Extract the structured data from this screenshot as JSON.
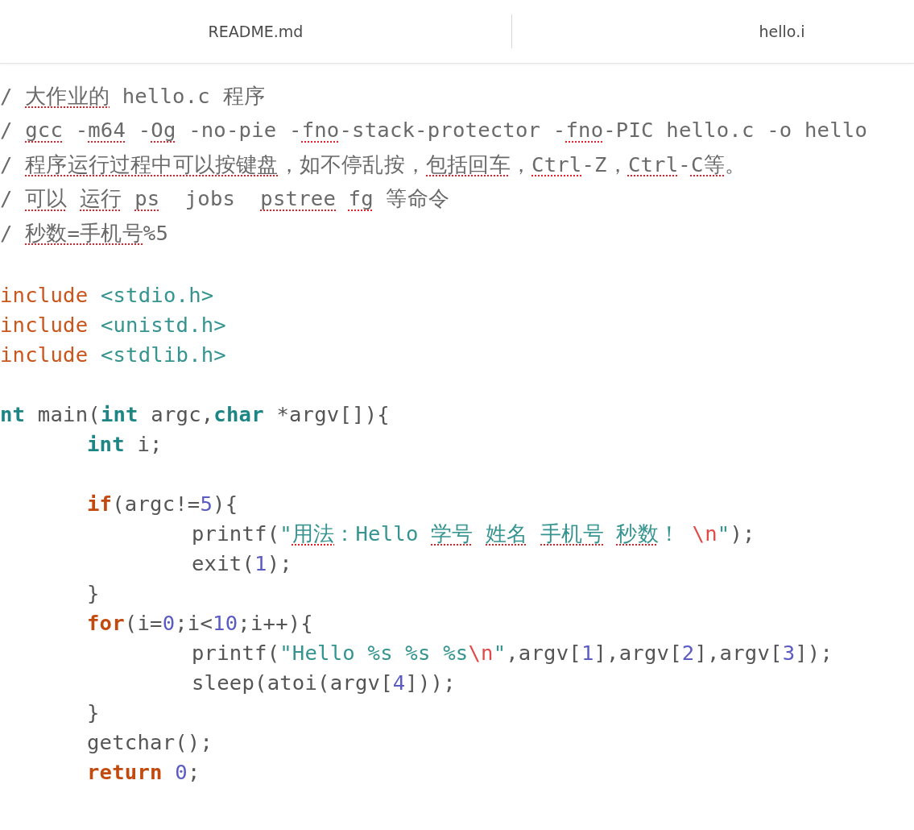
{
  "tabs": [
    {
      "label": "README.md",
      "selected": false
    },
    {
      "label": "hello.i",
      "selected": false
    }
  ],
  "code_lines": [
    {
      "kind": "comment",
      "tokens": [
        {
          "text": "/ ",
          "kind": "comment",
          "misspelled": false
        },
        {
          "text": "大作业的",
          "kind": "comment",
          "misspelled": true
        },
        {
          "text": " hello.c 程序",
          "kind": "comment",
          "misspelled": false
        }
      ]
    },
    {
      "kind": "comment",
      "tokens": [
        {
          "text": "/ ",
          "kind": "comment",
          "misspelled": false
        },
        {
          "text": "gcc",
          "kind": "comment",
          "misspelled": true
        },
        {
          "text": " -",
          "kind": "comment",
          "misspelled": false
        },
        {
          "text": "m64",
          "kind": "comment",
          "misspelled": true
        },
        {
          "text": " -",
          "kind": "comment",
          "misspelled": false
        },
        {
          "text": "Og",
          "kind": "comment",
          "misspelled": true
        },
        {
          "text": " -no-pie -",
          "kind": "comment",
          "misspelled": false
        },
        {
          "text": "fno",
          "kind": "comment",
          "misspelled": true
        },
        {
          "text": "-stack-protector -",
          "kind": "comment",
          "misspelled": false
        },
        {
          "text": "fno",
          "kind": "comment",
          "misspelled": true
        },
        {
          "text": "-PIC hello.c -o hello",
          "kind": "comment",
          "misspelled": false
        }
      ]
    },
    {
      "kind": "comment",
      "tokens": [
        {
          "text": "/ ",
          "kind": "comment",
          "misspelled": false
        },
        {
          "text": "程序运行过程中可以按键盘",
          "kind": "comment",
          "misspelled": true
        },
        {
          "text": "，如不停乱按，",
          "kind": "comment",
          "misspelled": false
        },
        {
          "text": "包括回车",
          "kind": "comment",
          "misspelled": true
        },
        {
          "text": "，",
          "kind": "comment",
          "misspelled": false
        },
        {
          "text": "Ctrl",
          "kind": "comment",
          "misspelled": true
        },
        {
          "text": "-Z，",
          "kind": "comment",
          "misspelled": false
        },
        {
          "text": "Ctrl",
          "kind": "comment",
          "misspelled": true
        },
        {
          "text": "-",
          "kind": "comment",
          "misspelled": false
        },
        {
          "text": "C等",
          "kind": "comment",
          "misspelled": true
        },
        {
          "text": "。",
          "kind": "comment",
          "misspelled": false
        }
      ]
    },
    {
      "kind": "comment",
      "tokens": [
        {
          "text": "/ ",
          "kind": "comment",
          "misspelled": false
        },
        {
          "text": "可以",
          "kind": "comment",
          "misspelled": true
        },
        {
          "text": " 运行",
          "kind": "comment",
          "misspelled": true
        },
        {
          "text": " ps",
          "kind": "comment",
          "misspelled": true
        },
        {
          "text": "  jobs  ",
          "kind": "comment",
          "misspelled": false
        },
        {
          "text": "pstree",
          "kind": "comment",
          "misspelled": true
        },
        {
          "text": " fg",
          "kind": "comment",
          "misspelled": true
        },
        {
          "text": " 等命令",
          "kind": "comment",
          "misspelled": false
        }
      ]
    },
    {
      "kind": "comment",
      "tokens": [
        {
          "text": "/ ",
          "kind": "comment",
          "misspelled": false
        },
        {
          "text": "秒数=手机号",
          "kind": "comment",
          "misspelled": true
        },
        {
          "text": "%5",
          "kind": "comment",
          "misspelled": false
        }
      ]
    },
    {
      "kind": "blank"
    },
    {
      "kind": "top",
      "tokens": [
        {
          "text": "include ",
          "kind": "preprocessor",
          "misspelled": false
        },
        {
          "text": "<stdio.h>",
          "kind": "string",
          "misspelled": false
        }
      ]
    },
    {
      "kind": "top",
      "tokens": [
        {
          "text": "include ",
          "kind": "preprocessor",
          "misspelled": false
        },
        {
          "text": "<unistd.h>",
          "kind": "string",
          "misspelled": false
        }
      ]
    },
    {
      "kind": "top",
      "tokens": [
        {
          "text": "include ",
          "kind": "preprocessor",
          "misspelled": false
        },
        {
          "text": "<stdlib.h>",
          "kind": "string",
          "misspelled": false
        }
      ]
    },
    {
      "kind": "blank"
    },
    {
      "kind": "top",
      "tokens": [
        {
          "text": "nt",
          "kind": "type",
          "misspelled": false
        },
        {
          "text": " main(",
          "kind": "plain",
          "misspelled": false
        },
        {
          "text": "int",
          "kind": "type",
          "misspelled": false
        },
        {
          "text": " argc,",
          "kind": "plain",
          "misspelled": false
        },
        {
          "text": "char",
          "kind": "type",
          "misspelled": false
        },
        {
          "text": " *argv[]){",
          "kind": "plain",
          "misspelled": false
        }
      ]
    },
    {
      "kind": "body",
      "tokens": [
        {
          "text": "int",
          "kind": "type",
          "misspelled": false
        },
        {
          "text": " i;",
          "kind": "plain",
          "misspelled": false
        }
      ]
    },
    {
      "kind": "blank"
    },
    {
      "kind": "body",
      "tokens": [
        {
          "text": "if",
          "kind": "control",
          "misspelled": false
        },
        {
          "text": "(argc!=",
          "kind": "plain",
          "misspelled": false
        },
        {
          "text": "5",
          "kind": "number",
          "misspelled": false
        },
        {
          "text": "){",
          "kind": "plain",
          "misspelled": false
        }
      ]
    },
    {
      "kind": "inner",
      "tokens": [
        {
          "text": "printf(",
          "kind": "plain",
          "misspelled": false
        },
        {
          "text": "\"",
          "kind": "string",
          "misspelled": false
        },
        {
          "text": "用法",
          "kind": "string",
          "misspelled": true
        },
        {
          "text": "：Hello ",
          "kind": "string",
          "misspelled": false
        },
        {
          "text": "学号",
          "kind": "string",
          "misspelled": true
        },
        {
          "text": " 姓名",
          "kind": "string",
          "misspelled": true
        },
        {
          "text": " 手机号",
          "kind": "string",
          "misspelled": true
        },
        {
          "text": " 秒数",
          "kind": "string",
          "misspelled": true
        },
        {
          "text": "！ ",
          "kind": "string",
          "misspelled": false
        },
        {
          "text": "\\n",
          "kind": "escape",
          "misspelled": false
        },
        {
          "text": "\"",
          "kind": "string",
          "misspelled": false
        },
        {
          "text": ");",
          "kind": "plain",
          "misspelled": false
        }
      ]
    },
    {
      "kind": "inner",
      "tokens": [
        {
          "text": "exit(",
          "kind": "plain",
          "misspelled": false
        },
        {
          "text": "1",
          "kind": "number",
          "misspelled": false
        },
        {
          "text": ");",
          "kind": "plain",
          "misspelled": false
        }
      ]
    },
    {
      "kind": "body",
      "tokens": [
        {
          "text": "}",
          "kind": "plain",
          "misspelled": false
        }
      ]
    },
    {
      "kind": "body",
      "tokens": [
        {
          "text": "for",
          "kind": "control",
          "misspelled": false
        },
        {
          "text": "(i=",
          "kind": "plain",
          "misspelled": false
        },
        {
          "text": "0",
          "kind": "number",
          "misspelled": false
        },
        {
          "text": ";i<",
          "kind": "plain",
          "misspelled": false
        },
        {
          "text": "10",
          "kind": "number",
          "misspelled": false
        },
        {
          "text": ";i++){",
          "kind": "plain",
          "misspelled": false
        }
      ]
    },
    {
      "kind": "inner",
      "tokens": [
        {
          "text": "printf(",
          "kind": "plain",
          "misspelled": false
        },
        {
          "text": "\"Hello %s %s %s",
          "kind": "string",
          "misspelled": false
        },
        {
          "text": "\\n",
          "kind": "escape",
          "misspelled": false
        },
        {
          "text": "\"",
          "kind": "string",
          "misspelled": false
        },
        {
          "text": ",argv[",
          "kind": "plain",
          "misspelled": false
        },
        {
          "text": "1",
          "kind": "number",
          "misspelled": false
        },
        {
          "text": "],argv[",
          "kind": "plain",
          "misspelled": false
        },
        {
          "text": "2",
          "kind": "number",
          "misspelled": false
        },
        {
          "text": "],argv[",
          "kind": "plain",
          "misspelled": false
        },
        {
          "text": "3",
          "kind": "number",
          "misspelled": false
        },
        {
          "text": "]);",
          "kind": "plain",
          "misspelled": false
        }
      ]
    },
    {
      "kind": "inner",
      "tokens": [
        {
          "text": "sleep(atoi(argv[",
          "kind": "plain",
          "misspelled": false
        },
        {
          "text": "4",
          "kind": "number",
          "misspelled": false
        },
        {
          "text": "]));",
          "kind": "plain",
          "misspelled": false
        }
      ]
    },
    {
      "kind": "body",
      "tokens": [
        {
          "text": "}",
          "kind": "plain",
          "misspelled": false
        }
      ]
    },
    {
      "kind": "body",
      "tokens": [
        {
          "text": "getchar();",
          "kind": "plain",
          "misspelled": false
        }
      ]
    },
    {
      "kind": "body",
      "tokens": [
        {
          "text": "return ",
          "kind": "control",
          "misspelled": false
        },
        {
          "text": "0",
          "kind": "number",
          "misspelled": false
        },
        {
          "text": ";",
          "kind": "plain",
          "misspelled": false
        }
      ]
    }
  ]
}
